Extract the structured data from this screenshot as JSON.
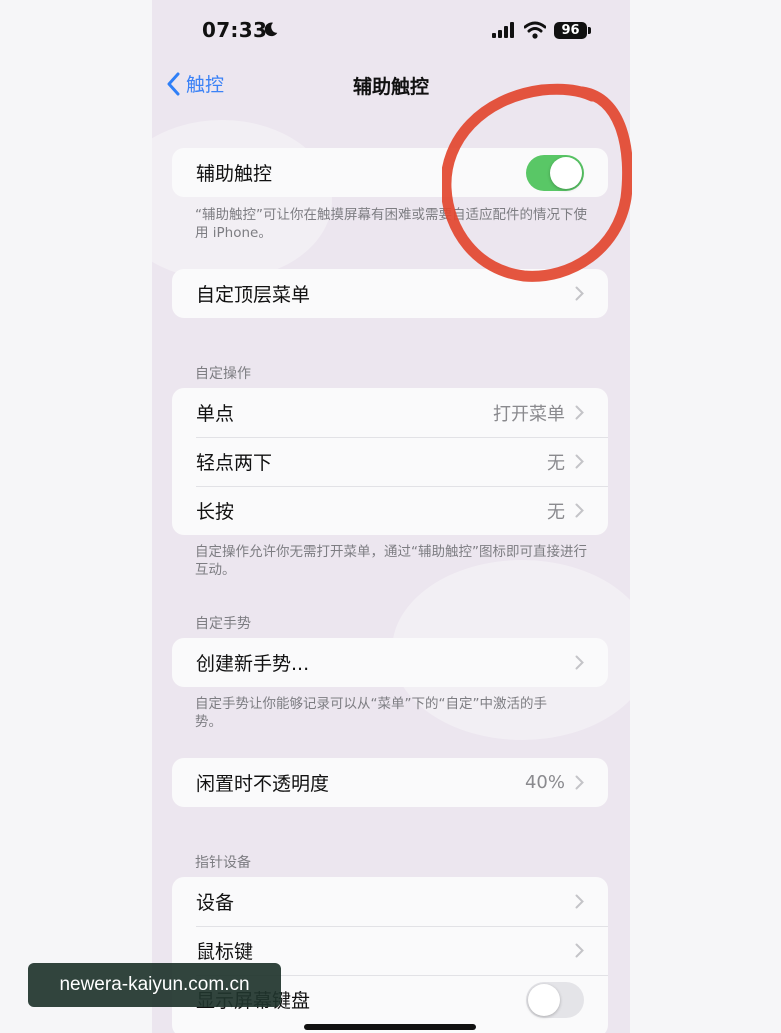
{
  "status_bar": {
    "time": "07:33",
    "battery": "96"
  },
  "nav": {
    "back_label": "触控",
    "title": "辅助触控"
  },
  "main_toggle": {
    "label": "辅助触控",
    "on": true,
    "footer": "“辅助触控”可让你在触摸屏幕有困难或需要自适应配件的情况下使用 iPhone。"
  },
  "top_menu": {
    "label": "自定顶层菜单"
  },
  "custom_actions": {
    "header": "自定操作",
    "rows": [
      {
        "label": "单点",
        "value": "打开菜单"
      },
      {
        "label": "轻点两下",
        "value": "无"
      },
      {
        "label": "长按",
        "value": "无"
      }
    ],
    "footer": "自定操作允许你无需打开菜单，通过“辅助触控”图标即可直接进行互动。"
  },
  "custom_gestures": {
    "header": "自定手势",
    "create_label": "创建新手势...",
    "footer": "自定手势让你能够记录可以从“菜单”下的“自定”中激活的手势。"
  },
  "idle_opacity": {
    "label": "闲置时不透明度",
    "value": "40%",
    "percent": 40
  },
  "pointer_devices": {
    "header": "指针设备",
    "rows": [
      {
        "label": "设备"
      },
      {
        "label": "鼠标键"
      },
      {
        "label": "显示屏幕键盘",
        "toggle": false
      }
    ]
  },
  "colors": {
    "accent": "#3b82f6",
    "toggle_on": "#59c766",
    "annotation": "#e2472f"
  },
  "watermark": "newera-kaiyun.com.cn"
}
